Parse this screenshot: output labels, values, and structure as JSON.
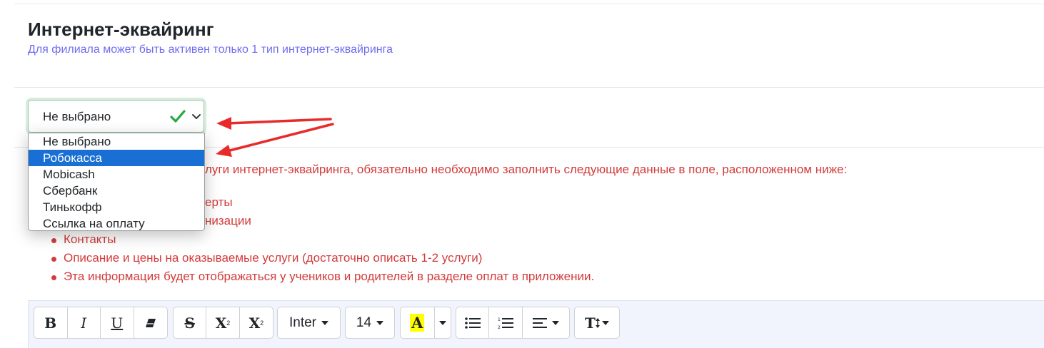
{
  "header": {
    "title": "Интернет-эквайринг",
    "subtitle": "Для филиала может быть активен только 1 тип интернет-эквайринга"
  },
  "select": {
    "value": "Не выбрано",
    "options": [
      "Не выбрано",
      "Робокасса",
      "Mobicash",
      "Сбербанк",
      "Тинькофф",
      "Ссылка на оплату"
    ],
    "highlighted": "Робокасса"
  },
  "notice": {
    "intro_visible": "луги интернет-эквайринга, обязательно необходимо заполнить следующие данные в поле, расположенном ниже:",
    "items_visible": [
      "ерты",
      "низации",
      "Контакты",
      "Описание и цены на оказываемые услуги (достаточно описать 1-2 услуги)",
      "Эта информация будет отображаться у учеников и родителей в разделе оплат в приложении."
    ]
  },
  "toolbar": {
    "bold": "B",
    "italic": "I",
    "underline": "U",
    "strikethrough": "S",
    "superscript": "X",
    "subscript": "X",
    "font_family": "Inter",
    "font_size": "14",
    "highlight_letter": "A",
    "text_style": "T"
  },
  "colors": {
    "subtitle": "#6f6cf0",
    "notice": "#d33b3b",
    "selected_option": "#1a6fd4",
    "check": "#28a745",
    "arrow": "#e82a2a",
    "highlight": "#ffff00"
  }
}
